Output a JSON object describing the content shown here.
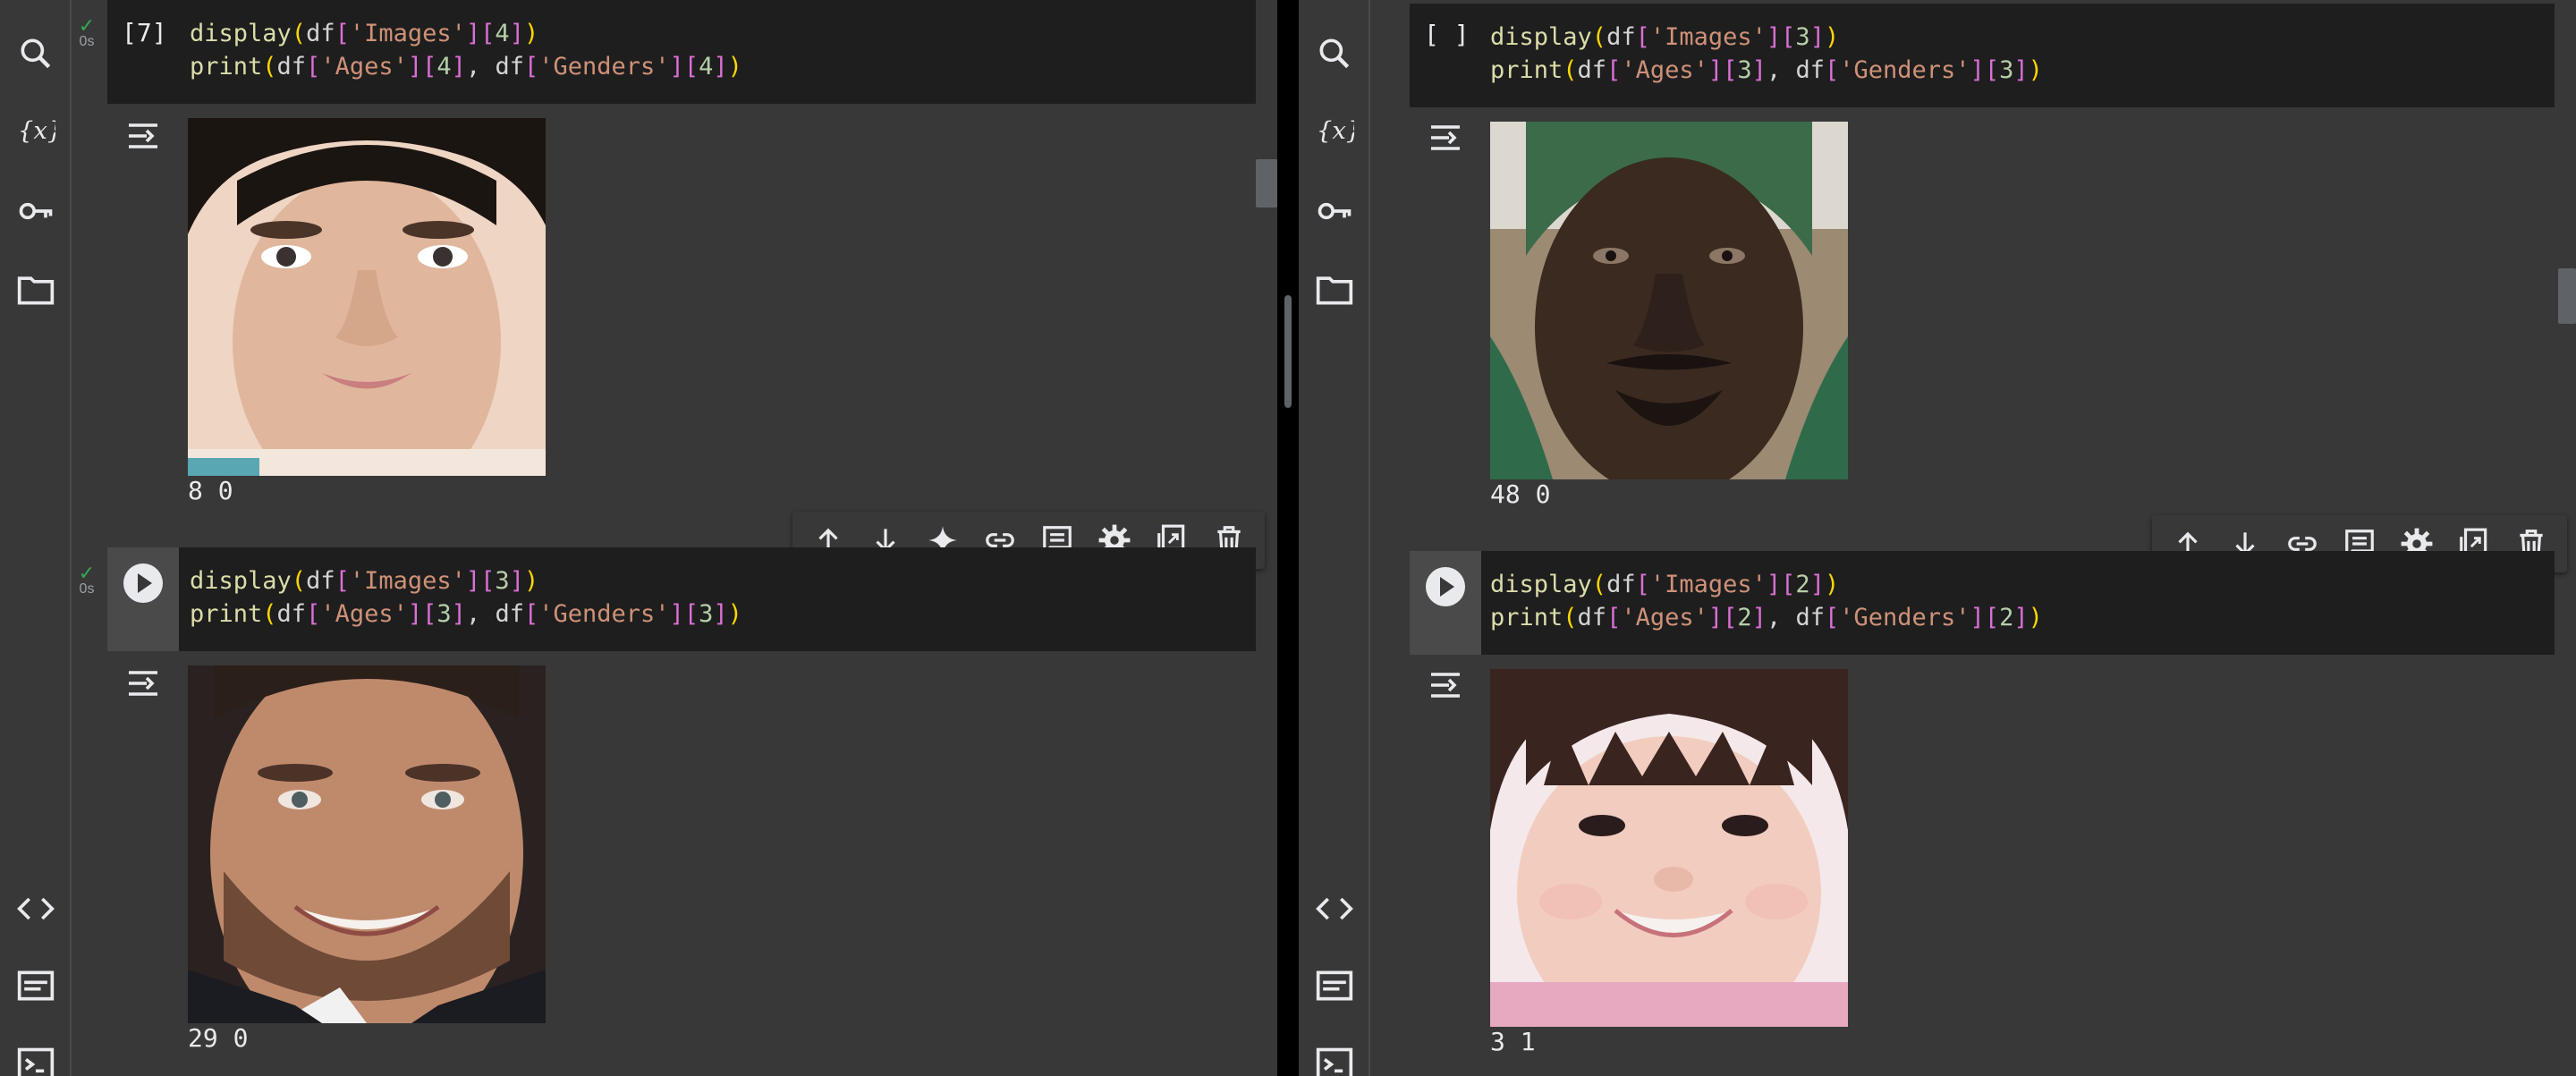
{
  "left": {
    "cells": [
      {
        "exec_count": "[7]",
        "status_time": "0s",
        "code_line1": [
          "display",
          "(",
          "df",
          "[",
          "'Images'",
          "]",
          "[",
          "4",
          "]",
          ")"
        ],
        "code_line2": [
          "print",
          "(",
          "df",
          "[",
          "'Ages'",
          "]",
          "[",
          "4",
          "]",
          ", ",
          "df",
          "[",
          "'Genders'",
          "]",
          "[",
          "4",
          "]",
          ")"
        ],
        "output": "8 0"
      },
      {
        "exec_count": "",
        "status_time": "0s",
        "code_line1": [
          "display",
          "(",
          "df",
          "[",
          "'Images'",
          "]",
          "[",
          "3",
          "]",
          ")"
        ],
        "code_line2": [
          "print",
          "(",
          "df",
          "[",
          "'Ages'",
          "]",
          "[",
          "3",
          "]",
          ", ",
          "df",
          "[",
          "'Genders'",
          "]",
          "[",
          "3",
          "]",
          ")"
        ],
        "output": "29 0"
      }
    ]
  },
  "right": {
    "cells": [
      {
        "exec_count": "[ ]",
        "code_line1": [
          "display",
          "(",
          "df",
          "[",
          "'Images'",
          "]",
          "[",
          "3",
          "]",
          ")"
        ],
        "code_line2": [
          "print",
          "(",
          "df",
          "[",
          "'Ages'",
          "]",
          "[",
          "3",
          "]",
          ", ",
          "df",
          "[",
          "'Genders'",
          "]",
          "[",
          "3",
          "]",
          ")"
        ],
        "output": "48 0"
      },
      {
        "exec_count": "",
        "code_line1": [
          "display",
          "(",
          "df",
          "[",
          "'Images'",
          "]",
          "[",
          "2",
          "]",
          ")"
        ],
        "code_line2": [
          "print",
          "(",
          "df",
          "[",
          "'Ages'",
          "]",
          "[",
          "2",
          "]",
          ", ",
          "df",
          "[",
          "'Genders'",
          "]",
          "[",
          "2",
          "]",
          ")"
        ],
        "output": "3 1"
      }
    ]
  },
  "rail_icons": [
    "search-icon",
    "variables-icon",
    "secrets-key-icon",
    "files-folder-icon",
    "code-snippets-icon",
    "command-palette-icon",
    "terminal-icon"
  ],
  "toolbar_left": [
    "move-up-icon",
    "move-down-icon",
    "gemini-sparkle-icon",
    "link-icon",
    "comment-icon",
    "settings-gear-icon",
    "mirror-cell-icon",
    "delete-icon"
  ],
  "toolbar_right": [
    "move-up-icon",
    "move-down-icon",
    "link-icon",
    "comment-icon",
    "settings-gear-icon",
    "mirror-cell-icon",
    "delete-icon"
  ],
  "faces": [
    "boy-face",
    "man-beard-face",
    "man-green-cap-face",
    "toddler-face"
  ],
  "colors": {
    "bg": "#383838",
    "code_bg": "#1e1e1e",
    "ok": "#34a853"
  }
}
